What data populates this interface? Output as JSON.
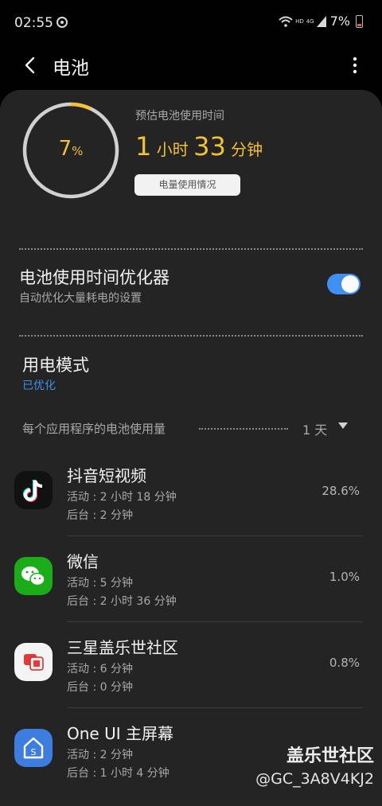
{
  "status_bar": {
    "time": "02:55",
    "battery_percent": "7%",
    "network_hd": "HD",
    "network_4g": "4G"
  },
  "header": {
    "title": "电池"
  },
  "battery": {
    "level_fraction": 0.07,
    "level_number": "7",
    "level_unit": "%",
    "estimate_label": "预估电池使用时间",
    "estimate_hours": "1",
    "estimate_hours_unit": " 小时 ",
    "estimate_minutes": "33",
    "estimate_minutes_unit": " 分钟",
    "usage_button": "电量使用情况",
    "ring_color": "#f1c232"
  },
  "optimizer": {
    "title": "电池使用时间优化器",
    "subtitle": "自动优化大量耗电的设置",
    "enabled": true
  },
  "power_mode": {
    "title": "用电模式",
    "value": "已优化"
  },
  "per_app": {
    "heading": "每个应用程序的电池使用量",
    "range": "1 天"
  },
  "apps": [
    {
      "name": "抖音短视频",
      "active": "活动 : 2 小时 18 分钟",
      "background": "后台 : 2 分钟",
      "percent": "28.6%",
      "icon": "tiktok-icon"
    },
    {
      "name": "微信",
      "active": "活动 : 5 分钟",
      "background": "后台 : 2 小时 36 分钟",
      "percent": "1.0%",
      "icon": "wechat-icon"
    },
    {
      "name": "三星盖乐世社区",
      "active": "活动 : 6 分钟",
      "background": "后台 : 0 分钟",
      "percent": "0.8%",
      "icon": "samsung-members-icon"
    },
    {
      "name": "One UI 主屏幕",
      "active": "活动 : 2 分钟",
      "background": "后台 : 1 小时 4 分钟",
      "percent": "",
      "icon": "oneui-home-icon"
    }
  ],
  "watermark": {
    "line1": "盖乐世社区",
    "line2": "@GC_3A8V4KJ2"
  }
}
